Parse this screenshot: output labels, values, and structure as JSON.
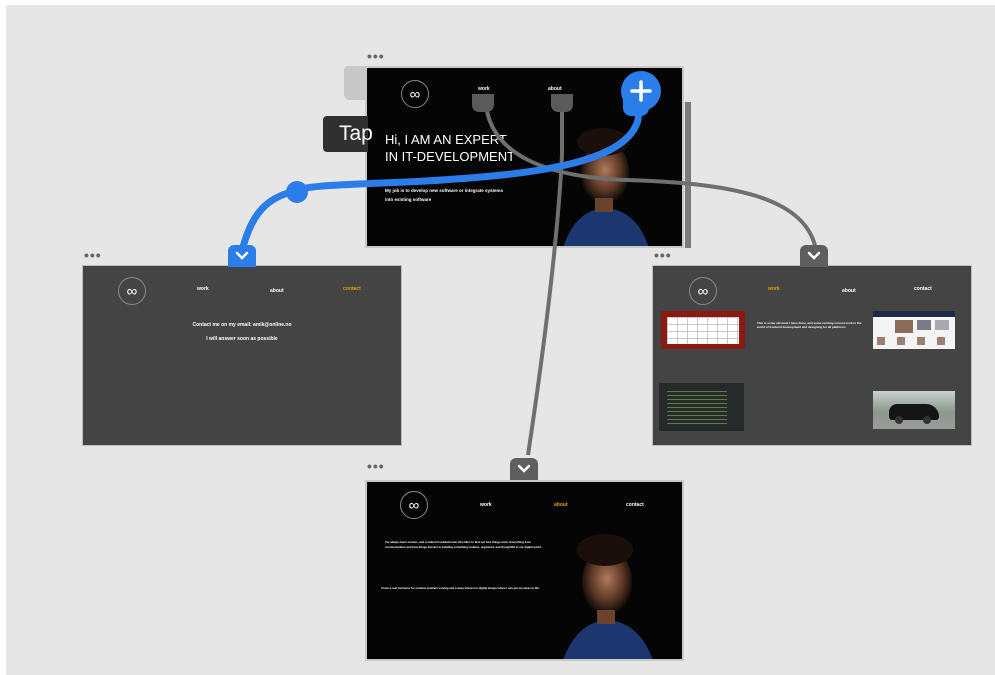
{
  "canvas": {
    "background": "#e6e6e6"
  },
  "connector_colors": {
    "active": "#2b7de9",
    "inactive": "#6f6f6f"
  },
  "tooltip": {
    "label": "Tap"
  },
  "frames": {
    "home": {
      "nav": [
        "work",
        "about"
      ],
      "headline_line1": "Hi, I AM AN EXPERT",
      "headline_line2": "IN IT-DEVELOPMENT",
      "body_line1": "My job is to develop new software or integrate systems",
      "body_line2": "into existing software"
    },
    "contact": {
      "nav": [
        "work",
        "about",
        "contact"
      ],
      "active_nav": "contact",
      "line1": "Contact me on my email: amik@online.no",
      "line2": "I will answer soon as possible"
    },
    "work": {
      "nav": [
        "work",
        "about",
        "contact"
      ],
      "active_nav": "work",
      "intro": "This is some old work I have done, and some exciting current work in the world of frontend development and designing for all platforms",
      "thumbnails": [
        "calendar-table",
        "news-website",
        "code-editor",
        "sports-car"
      ]
    },
    "about": {
      "nav": [
        "work",
        "about",
        "contact"
      ],
      "active_nav": "about",
      "para1": "I've always been curious, and a natural troubleshooter who likes to find out how things work. Everything from communication and how things interact to building something creative, organized, and thoughtful in our digital world.",
      "para2": "I have a real fondness for creative problem solving and a deep interest in digital design where I can put my ideas to life."
    }
  }
}
